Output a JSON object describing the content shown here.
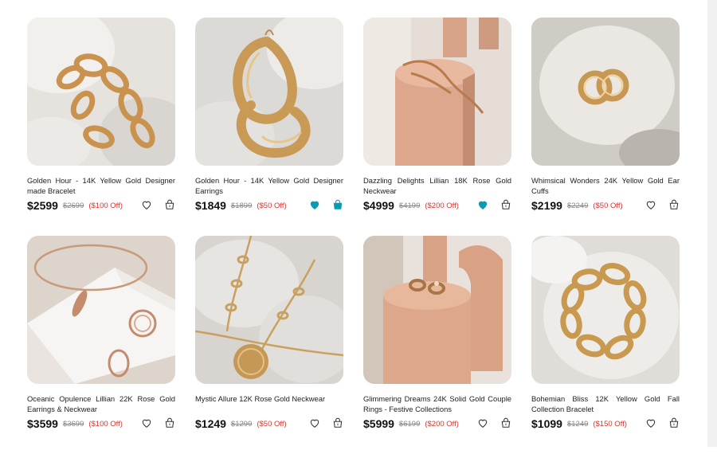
{
  "accent_color": "#0a9bb0",
  "sale_color": "#e0322b",
  "products": [
    {
      "title": "Golden Hour - 14K Yellow Gold Designer made Bracelet",
      "price": "$2599",
      "original_price": "$2699",
      "discount": "($100 Off)",
      "wishlisted": false,
      "in_cart": false,
      "image": "gold chain bracelet on white stones"
    },
    {
      "title": "Golden Hour - 14K Yellow Gold Designer Earrings",
      "price": "$1849",
      "original_price": "$1899",
      "discount": "($50 Off)",
      "wishlisted": true,
      "in_cart": true,
      "image": "twisted gold hoop earrings on stones"
    },
    {
      "title": "Dazzling Delights Lillian 18K Rose Gold Neckwear",
      "price": "$4999",
      "original_price": "$4199",
      "discount": "($200 Off)",
      "wishlisted": true,
      "in_cart": false,
      "image": "rose gold chain on peach cylinder"
    },
    {
      "title": "Whimsical Wonders 24K Yellow Gold Ear Cuffs",
      "price": "$2199",
      "original_price": "$2249",
      "discount": "($50 Off)",
      "wishlisted": false,
      "in_cart": false,
      "image": "gold ear cuffs on white stone"
    },
    {
      "title": "Oceanic Opulence Lillian 22K Rose Gold Earrings & Neckwear",
      "price": "$3599",
      "original_price": "$3699",
      "discount": "($100 Off)",
      "wishlisted": false,
      "in_cart": false,
      "image": "rose gold bangle and earrings on white block"
    },
    {
      "title": "Mystic Allure 12K Rose Gold Neckwear",
      "price": "$1249",
      "original_price": "$1299",
      "discount": "($50 Off)",
      "wishlisted": false,
      "in_cart": false,
      "image": "gold chain with coin pendant on stones"
    },
    {
      "title": "Glimmering Dreams 24K Solid Gold Couple Rings - Festive Collections",
      "price": "$5999",
      "original_price": "$6199",
      "discount": "($200 Off)",
      "wishlisted": false,
      "in_cart": false,
      "image": "gold rings on peach cylinder"
    },
    {
      "title": "Bohemian Bliss 12K Yellow Gold Fall Collection Bracelet",
      "price": "$1099",
      "original_price": "$1249",
      "discount": "($150 Off)",
      "wishlisted": false,
      "in_cart": false,
      "image": "gold link bracelet on white stones"
    }
  ]
}
